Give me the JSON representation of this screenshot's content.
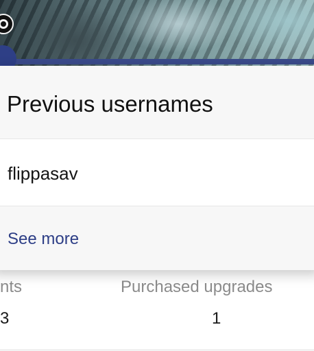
{
  "modal": {
    "title": "Previous usernames",
    "usernames": [
      "flippasav"
    ],
    "see_more_label": "See more"
  },
  "stats": {
    "left_label_partial": "nts",
    "left_value_partial": "3",
    "purchased_label": "Purchased upgrades",
    "purchased_value": "1"
  },
  "colors": {
    "link": "#2d3e86",
    "banner_accent": "#3a4a8a"
  },
  "icons": {
    "badge": "camera-badge-icon"
  }
}
